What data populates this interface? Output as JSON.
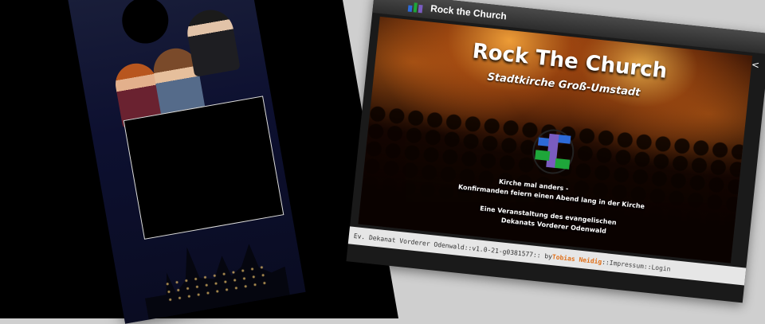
{
  "window": {
    "title": "Rock the Church",
    "accent_colors": [
      "#2d6ad8",
      "#1ea63a",
      "#7a5cc0"
    ]
  },
  "hero": {
    "title": "Rock The Church",
    "subtitle": "Stadtkirche Groß-Umstadt",
    "line1": "Kirche mal anders -",
    "line2": "Konfirmanden feiern einen Abend lang in der Kirche",
    "line3": "Eine Veranstaltung des evangelischen",
    "line4": "Dekanats Vorderer Odenwald"
  },
  "footer": {
    "org": "Ev. Dekanat Vorderer Odenwald",
    "sep1": " :: ",
    "version": "v1.0-21-g0381577",
    "sep2": " :: by ",
    "author": "Tobias Neidig",
    "sep3": " :: ",
    "impressum": "Impressum",
    "sep4": " :: ",
    "login": "Login"
  },
  "icons": {
    "share": "share-icon",
    "app": "app-logo-icon"
  }
}
